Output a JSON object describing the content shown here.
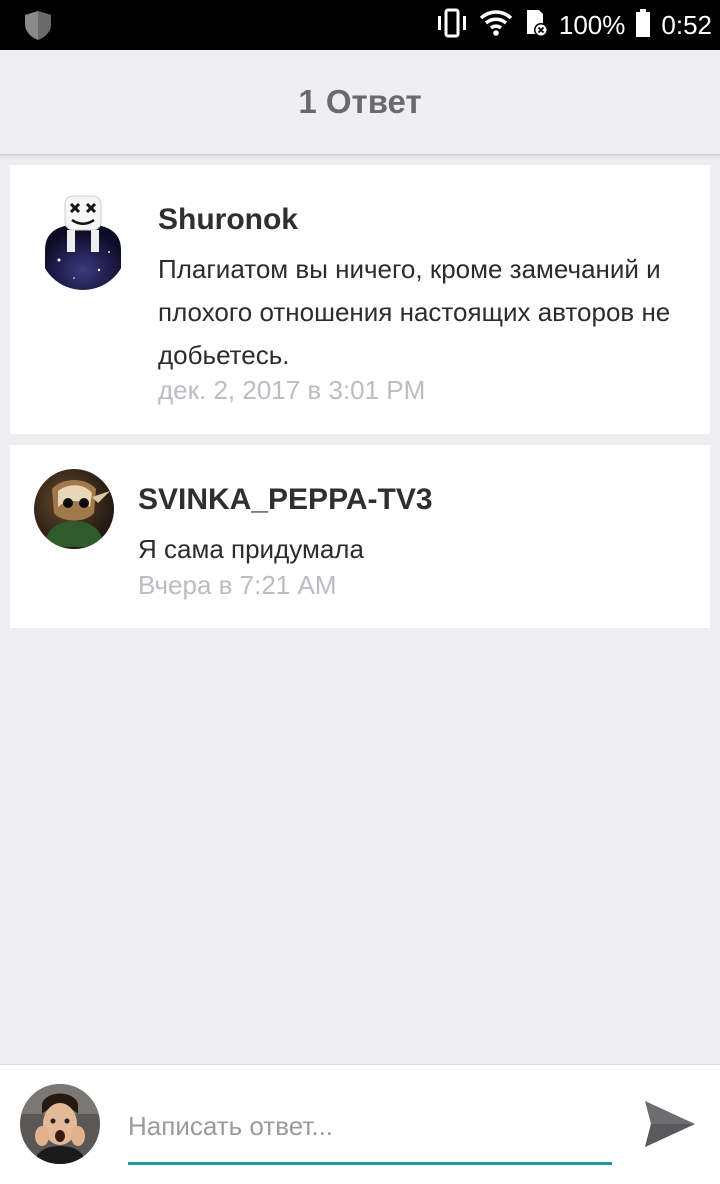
{
  "status_bar": {
    "battery": "100%",
    "time": "0:52",
    "icons": [
      "shield-icon",
      "vibrate-icon",
      "wifi-icon",
      "sd-card-icon",
      "battery-icon"
    ]
  },
  "header": {
    "title": "1 Ответ"
  },
  "comments": [
    {
      "author": "Shuronok",
      "message": "Плагиатом вы ничего, кроме замечаний и плохого отношения настоящих авторов не добьетесь.",
      "timestamp": "дек. 2, 2017 в 3:01 PM"
    },
    {
      "author": "SVINKA_PEPPA-TV3",
      "message": "Я сама придумала",
      "timestamp": "Вчера в 7:21 AM"
    }
  ],
  "reply": {
    "placeholder": "Написать ответ...",
    "accent_color": "#1d9aa8"
  }
}
